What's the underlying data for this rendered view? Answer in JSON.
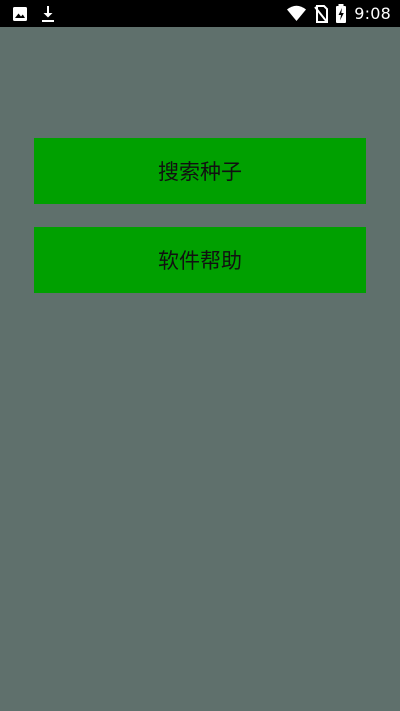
{
  "status_bar": {
    "time": "9:08",
    "icons": {
      "left": [
        "image-icon",
        "download-icon"
      ],
      "right": [
        "wifi-icon",
        "no-sim-icon",
        "battery-charging-icon"
      ]
    }
  },
  "main": {
    "buttons": [
      {
        "label": "搜索种子"
      },
      {
        "label": "软件帮助"
      }
    ]
  },
  "colors": {
    "background": "#5f706c",
    "status_bar": "#000000",
    "button": "#00a000",
    "button_text": "#111111"
  }
}
